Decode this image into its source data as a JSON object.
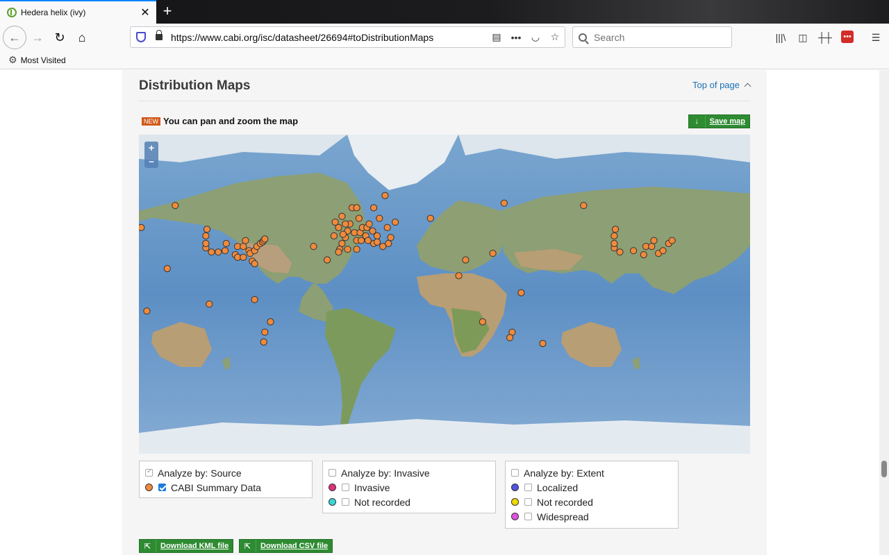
{
  "browser": {
    "tab_title": "Hedera helix (ivy)",
    "url": "https://www.cabi.org/isc/datasheet/26694#toDistributionMaps",
    "search_placeholder": "Search",
    "bookmarks_label": "Most Visited"
  },
  "section": {
    "title": "Distribution Maps",
    "top_link": "Top of page",
    "new_badge": "NEW",
    "pan_text": "You can pan and zoom the map",
    "save_map": "Save map"
  },
  "map": {
    "zoom_in": "+",
    "zoom_out": "–",
    "marker_color": "#f08a3c",
    "point_lonlat": [
      [
        -180,
        50
      ],
      [
        -150,
        61
      ],
      [
        -122,
        49
      ],
      [
        -123,
        37
      ],
      [
        -123,
        40
      ],
      [
        -123,
        45
      ],
      [
        -118,
        34
      ],
      [
        -112,
        34
      ],
      [
        -106,
        35
      ],
      [
        -105,
        40
      ],
      [
        -97,
        32
      ],
      [
        -95,
        30
      ],
      [
        -95,
        38
      ],
      [
        -90,
        30
      ],
      [
        -90,
        38
      ],
      [
        -88,
        42
      ],
      [
        -85,
        35
      ],
      [
        -84,
        33
      ],
      [
        -82,
        27
      ],
      [
        -80,
        35
      ],
      [
        -78,
        38
      ],
      [
        -75,
        40
      ],
      [
        -73,
        41
      ],
      [
        -72,
        42
      ],
      [
        -71,
        43
      ],
      [
        -80,
        25
      ],
      [
        -157,
        21
      ],
      [
        -175,
        -16
      ],
      [
        -120,
        -10
      ],
      [
        -80,
        -6
      ],
      [
        -71,
        -33
      ],
      [
        -72,
        -40
      ],
      [
        -66,
        -25
      ],
      [
        -28,
        38
      ],
      [
        -16,
        28
      ],
      [
        -10,
        45
      ],
      [
        -9,
        53
      ],
      [
        -6,
        50
      ],
      [
        -3,
        56
      ],
      [
        -3,
        40
      ],
      [
        0,
        44
      ],
      [
        2,
        48
      ],
      [
        4,
        52
      ],
      [
        6,
        60
      ],
      [
        8,
        47
      ],
      [
        10,
        60
      ],
      [
        12,
        55
      ],
      [
        13,
        47
      ],
      [
        15,
        50
      ],
      [
        19,
        50
      ],
      [
        21,
        52
      ],
      [
        24,
        48
      ],
      [
        25,
        60
      ],
      [
        28,
        45
      ],
      [
        30,
        55
      ],
      [
        35,
        65
      ],
      [
        2,
        36
      ],
      [
        10,
        36
      ],
      [
        25,
        40
      ],
      [
        33,
        38
      ],
      [
        38,
        40
      ],
      [
        40,
        44
      ],
      [
        44,
        53
      ],
      [
        10,
        42
      ],
      [
        14,
        42
      ],
      [
        18,
        45
      ],
      [
        -5,
        36
      ],
      [
        -6,
        34
      ],
      [
        -2,
        46
      ],
      [
        0,
        52
      ],
      [
        20,
        42
      ],
      [
        37,
        50
      ],
      [
        28,
        41
      ],
      [
        75,
        55
      ],
      [
        100,
        15
      ],
      [
        106,
        28
      ],
      [
        130,
        33
      ],
      [
        140,
        62
      ],
      [
        155,
        0
      ],
      [
        121,
        -25
      ],
      [
        147,
        -33
      ],
      [
        145,
        -37
      ],
      [
        174,
        -41
      ]
    ],
    "wrap_lonlat": [
      [
        -122,
        49
      ],
      [
        -123,
        37
      ],
      [
        -123,
        40
      ],
      [
        -123,
        45
      ],
      [
        -118,
        34
      ],
      [
        -106,
        35
      ],
      [
        -97,
        32
      ],
      [
        -95,
        38
      ],
      [
        -90,
        38
      ],
      [
        -88,
        42
      ],
      [
        -84,
        33
      ],
      [
        -80,
        35
      ],
      [
        -75,
        40
      ],
      [
        -72,
        42
      ],
      [
        -150,
        61
      ]
    ]
  },
  "legend": {
    "source_title": "Analyze by: Source",
    "source_item": "CABI Summary Data",
    "invasive_title": "Analyze by: Invasive",
    "invasive_item1": "Invasive",
    "invasive_item2": "Not recorded",
    "extent_title": "Analyze by: Extent",
    "extent_item1": "Localized",
    "extent_item2": "Not recorded",
    "extent_item3": "Widespread"
  },
  "downloads": {
    "kml": "Download KML file",
    "csv": "Download CSV file"
  }
}
